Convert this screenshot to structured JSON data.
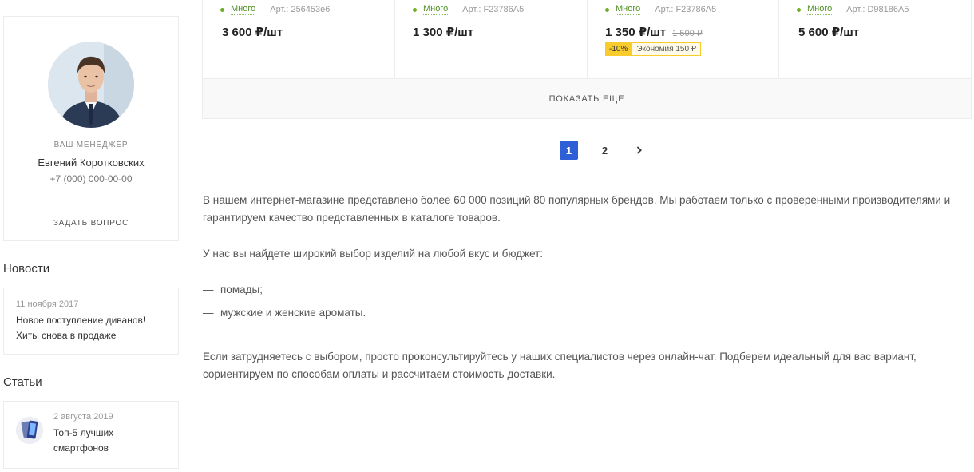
{
  "manager": {
    "role": "Ваш менеджер",
    "name": "Евгений Коротковских",
    "phone": "+7 (000) 000-00-00",
    "ask_label": "Задать вопрос"
  },
  "news": {
    "title": "Новости",
    "items": [
      {
        "date": "11 ноября 2017",
        "text": "Новое поступление диванов! Хиты снова в продаже"
      }
    ]
  },
  "articles": {
    "title": "Статьи",
    "items": [
      {
        "date": "2 августа 2019",
        "text": "Топ-5 лучших смартфонов"
      }
    ]
  },
  "products": [
    {
      "stock": "Много",
      "sku": "Арт.: 256453e6",
      "price": "3 600 ₽/шт"
    },
    {
      "stock": "Много",
      "sku": "Арт.: F23786A5",
      "price": "1 300 ₽/шт"
    },
    {
      "stock": "Много",
      "sku": "Арт.: F23786A5",
      "price": "1 350 ₽/шт",
      "old_price": "1 500 ₽",
      "discount": "-10%",
      "savings": "Экономия 150 ₽"
    },
    {
      "stock": "Много",
      "sku": "Арт.: D98186A5",
      "price": "5 600 ₽/шт"
    }
  ],
  "show_more_label": "Показать еще",
  "pagination": {
    "pages": [
      "1",
      "2"
    ],
    "current": "1"
  },
  "description": {
    "p1": "В нашем интернет-магазине представлено более 60 000 позиций 80 популярных брендов. Мы работаем только с проверенными производителями и гарантируем качество представленных в каталоге товаров.",
    "p2": "У нас вы найдете широкий выбор изделий на любой вкус и бюджет:",
    "list_dash": "—",
    "list": [
      "помады;",
      "мужские и женские ароматы."
    ],
    "p3": "Если затрудняетесь с выбором, просто проконсультируйтесь у наших специалистов через онлайн-чат. Подберем идеальный для вас вариант, сориентируем по способам оплаты и рассчитаем стоимость доставки."
  },
  "colors": {
    "accent": "#2f5fd6",
    "stock": "#4d8f1e",
    "discount": "#f8cc2d"
  }
}
